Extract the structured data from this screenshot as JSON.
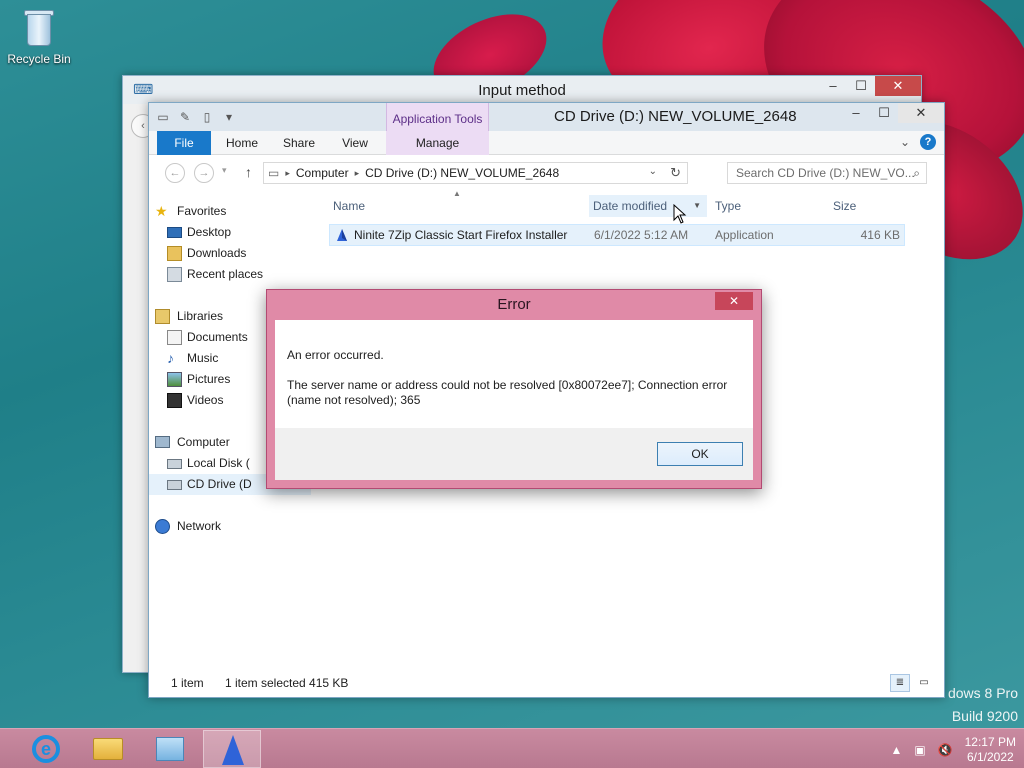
{
  "desktop": {
    "recycle_bin_label": "Recycle Bin",
    "watermark_line1": "dows 8 Pro",
    "watermark_line2": "Build 9200"
  },
  "back_window": {
    "title": "Input method"
  },
  "explorer": {
    "title": "CD Drive (D:) NEW_VOLUME_2648",
    "context_tab_group": "Application Tools",
    "tabs": {
      "file": "File",
      "home": "Home",
      "share": "Share",
      "view": "View",
      "manage": "Manage"
    },
    "address": {
      "part1": "Computer",
      "part2": "CD Drive (D:) NEW_VOLUME_2648"
    },
    "search_placeholder": "Search CD Drive (D:) NEW_VO...",
    "nav": {
      "favorites": "Favorites",
      "desktop": "Desktop",
      "downloads": "Downloads",
      "recent": "Recent places",
      "libraries": "Libraries",
      "documents": "Documents",
      "music": "Music",
      "pictures": "Pictures",
      "videos": "Videos",
      "computer": "Computer",
      "local_disk": "Local Disk (",
      "cd_drive": "CD Drive (D",
      "network": "Network"
    },
    "columns": {
      "name": "Name",
      "date": "Date modified",
      "type": "Type",
      "size": "Size"
    },
    "files": [
      {
        "name": "Ninite 7Zip Classic Start Firefox Installer",
        "date": "6/1/2022 5:12 AM",
        "type": "Application",
        "size": "416 KB"
      }
    ],
    "status": {
      "count": "1 item",
      "selected": "1 item selected  415 KB"
    }
  },
  "dialog": {
    "title": "Error",
    "message1": "An error occurred.",
    "message2": "The server name or address could not be resolved [0x80072ee7]; Connection error (name not resolved); 365",
    "ok_label": "OK"
  },
  "taskbar": {
    "time": "12:17 PM",
    "date": "6/1/2022"
  },
  "colors": {
    "accent": "#1979ca",
    "dialog_frame": "#e08aa7",
    "taskbar": "#c98aa0",
    "app_tools": "#ecdcf4"
  }
}
